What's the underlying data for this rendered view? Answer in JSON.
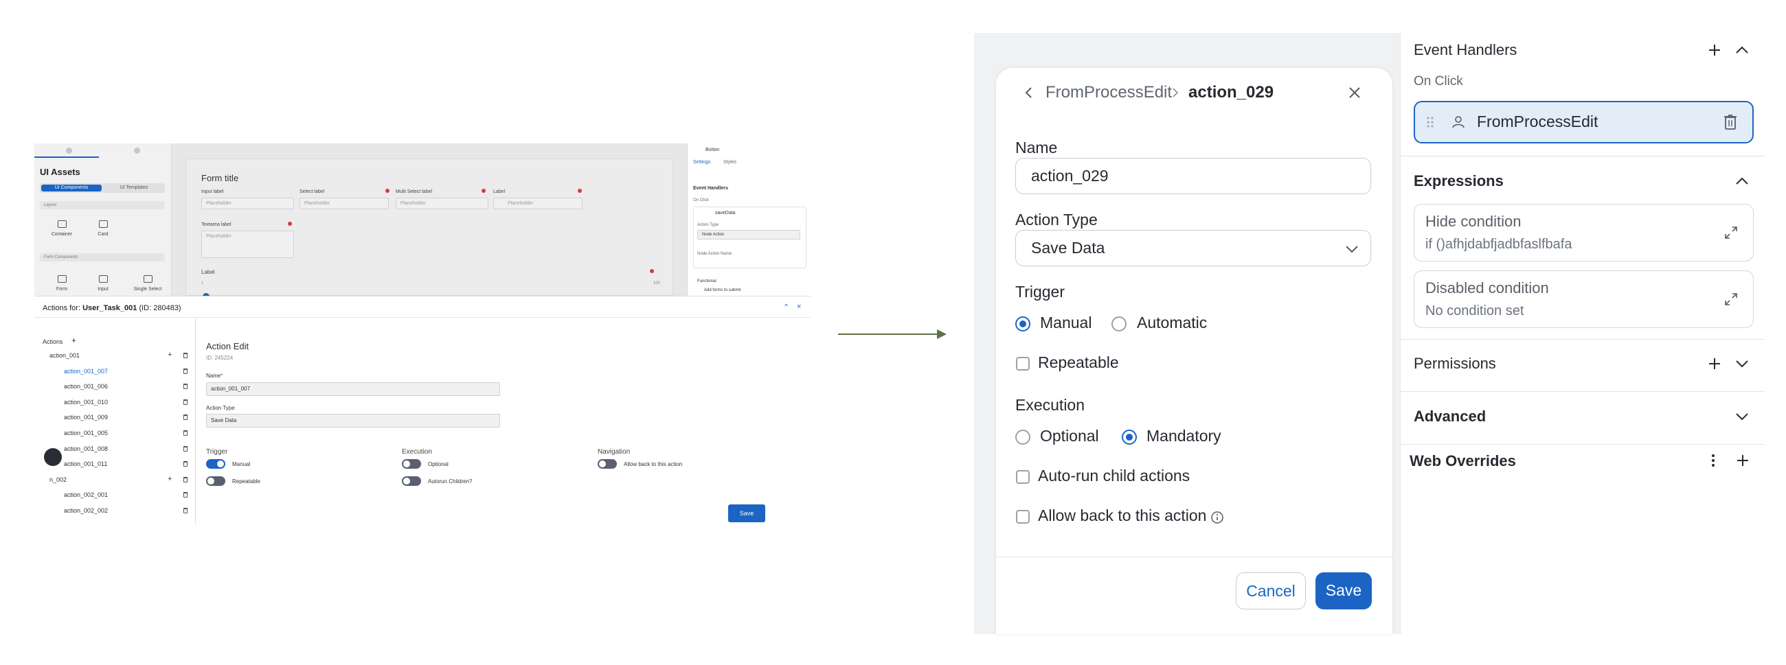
{
  "left_screenshot": {
    "sidebar_title": "UI Assets",
    "seg_tabs": [
      "UI Components",
      "UI Templates"
    ],
    "group_layout": "Layout",
    "tiles_layout": [
      "Container",
      "Card"
    ],
    "group_form": "Form Components",
    "tiles_form": [
      "Form",
      "Input",
      "Single Select"
    ],
    "form_title": "Form title",
    "input_label": "Input label",
    "select_label": "Select label",
    "multi_select_label": "Multi Select label",
    "label": "Label",
    "placeholder": "Placeholder",
    "textarea_label": "Textarea label",
    "slider_label": "Label",
    "slider_min": "1",
    "slider_max": "100",
    "rp_title": "Button",
    "rp_tabs": [
      "Settings",
      "Styles"
    ],
    "rp_event_handlers": "Event Handlers",
    "rp_on_click": "On Click",
    "rp_handler": "saveData",
    "rp_action_type": "Action Type",
    "rp_action_type_value": "Node Action",
    "rp_node_action_name": "Node Action Name",
    "rp_functional": "Functional",
    "rp_add_forms": "Add forms to submit",
    "actions_for_prefix": "Actions for: ",
    "actions_for_task": "User_Task_001",
    "actions_for_id": "(ID: 280483)",
    "actions_label": "Actions",
    "tree": [
      {
        "label": "action_001",
        "level": 0
      },
      {
        "label": "action_001_007",
        "level": 1,
        "selected": true
      },
      {
        "label": "action_001_006",
        "level": 1
      },
      {
        "label": "action_001_010",
        "level": 1
      },
      {
        "label": "action_001_009",
        "level": 1
      },
      {
        "label": "action_001_005",
        "level": 1
      },
      {
        "label": "action_001_008",
        "level": 1
      },
      {
        "label": "action_001_011",
        "level": 1
      },
      {
        "label": "n_002",
        "level": 0
      },
      {
        "label": "action_002_001",
        "level": 1
      },
      {
        "label": "action_002_002",
        "level": 1
      }
    ],
    "action_edit_title": "Action Edit",
    "action_edit_id": "ID: 245224",
    "name_label": "Name",
    "name_value": "action_001_007",
    "action_type_label": "Action Type",
    "action_type_value": "Save Data",
    "trigger_label": "Trigger",
    "trigger_manual": "Manual",
    "trigger_repeatable": "Repeatable",
    "execution_label": "Execution",
    "exec_optional": "Optional",
    "exec_autorun": "Autorun Children?",
    "navigation_label": "Navigation",
    "nav_allow_back": "Allow back to this action",
    "save_label": "Save"
  },
  "modal": {
    "breadcrumb_parent": "FromProcessEdit",
    "breadcrumb_current": "action_029",
    "name_label": "Name",
    "name_value": "action_029",
    "action_type_label": "Action Type",
    "action_type_value": "Save Data",
    "trigger_label": "Trigger",
    "trigger_options": [
      "Manual",
      "Automatic"
    ],
    "trigger_selected": "Manual",
    "repeatable_label": "Repeatable",
    "execution_label": "Execution",
    "execution_options": [
      "Optional",
      "Mandatory"
    ],
    "execution_selected": "Mandatory",
    "autorun_label": "Auto-run child actions",
    "allow_back_label": "Allow back to this action",
    "cancel_label": "Cancel",
    "save_label": "Save"
  },
  "right_panel": {
    "event_handlers_title": "Event Handlers",
    "on_click_label": "On Click",
    "handler_name": "FromProcessEdit",
    "expressions_title": "Expressions",
    "hide_condition_label": "Hide condition",
    "hide_condition_value": "if ()afhjdabfjadbfaslfbafa",
    "disabled_condition_label": "Disabled condition",
    "disabled_condition_value": "No condition set",
    "permissions_title": "Permissions",
    "advanced_title": "Advanced",
    "web_overrides_title": "Web Overrides"
  },
  "colors": {
    "accent": "#1b64c4",
    "arrow": "#5e7047",
    "selected_card_bg": "#e3edf8"
  },
  "icons": [
    "back-chevron-icon",
    "breadcrumb-chevron-icon",
    "close-icon",
    "select-chevron-icon",
    "info-icon",
    "plus-icon",
    "chevron-up-icon",
    "chevron-down-icon",
    "drag-handle-icon",
    "user-icon",
    "trash-icon",
    "expand-icon",
    "more-vertical-icon"
  ]
}
